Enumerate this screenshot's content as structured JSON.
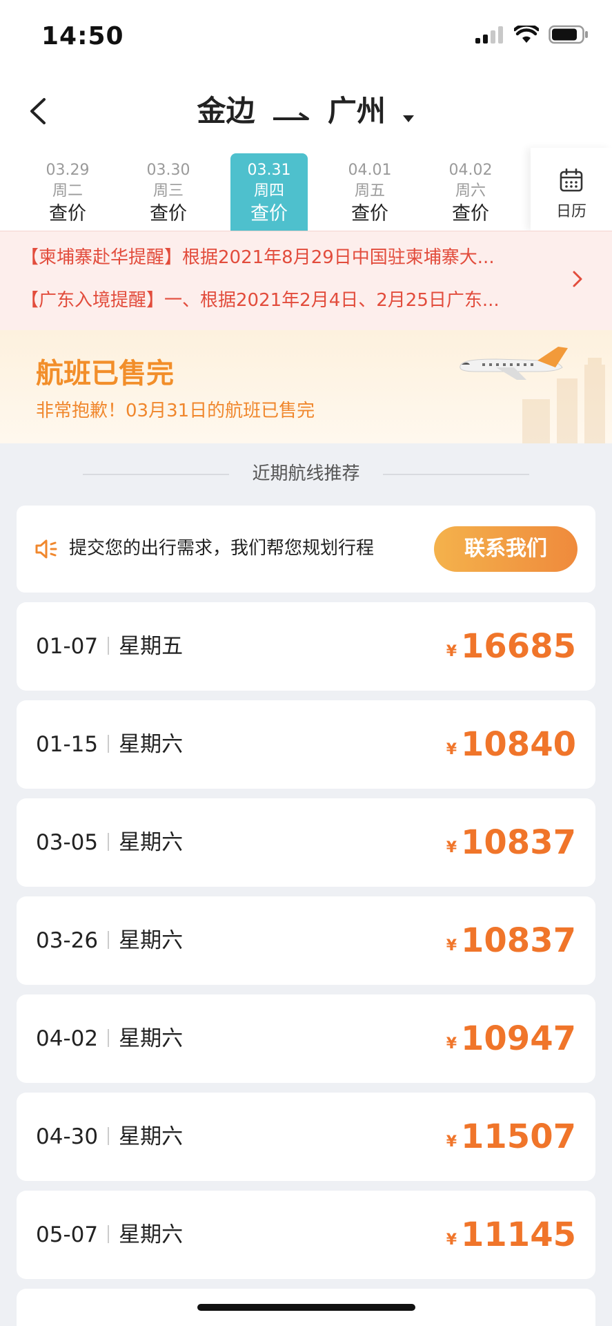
{
  "status": {
    "time": "14:50"
  },
  "header": {
    "from": "金边",
    "to": "广州"
  },
  "date_tabs": [
    {
      "date": "03.29",
      "weekday": "周二",
      "price": "查价",
      "active": false
    },
    {
      "date": "03.30",
      "weekday": "周三",
      "price": "查价",
      "active": false
    },
    {
      "date": "03.31",
      "weekday": "周四",
      "price": "查价",
      "active": true
    },
    {
      "date": "04.01",
      "weekday": "周五",
      "price": "查价",
      "active": false
    },
    {
      "date": "04.02",
      "weekday": "周六",
      "price": "查价",
      "active": false
    }
  ],
  "calendar": {
    "label": "日历"
  },
  "notices": [
    "【柬埔寨赴华提醒】根据2021年8月29日中国驻柬埔寨大...",
    "【广东入境提醒】一、根据2021年2月4日、2月25日广东..."
  ],
  "soldout": {
    "title": "航班已售完",
    "subtitle": "非常抱歉！03月31日的航班已售完"
  },
  "section": {
    "title": "近期航线推荐"
  },
  "contact": {
    "text": "提交您的出行需求，我们帮您规划行程",
    "button": "联系我们"
  },
  "currency": "¥",
  "recommendations": [
    {
      "date": "01-07",
      "weekday": "星期五",
      "price": "16685"
    },
    {
      "date": "01-15",
      "weekday": "星期六",
      "price": "10840"
    },
    {
      "date": "03-05",
      "weekday": "星期六",
      "price": "10837"
    },
    {
      "date": "03-26",
      "weekday": "星期六",
      "price": "10837"
    },
    {
      "date": "04-02",
      "weekday": "星期六",
      "price": "10947"
    },
    {
      "date": "04-30",
      "weekday": "星期六",
      "price": "11507"
    },
    {
      "date": "05-07",
      "weekday": "星期六",
      "price": "11145"
    }
  ],
  "colors": {
    "accent": "#4ec0cd",
    "price": "#f0752a",
    "notice": "#e24c3c",
    "soldout": "#f28e2a"
  }
}
